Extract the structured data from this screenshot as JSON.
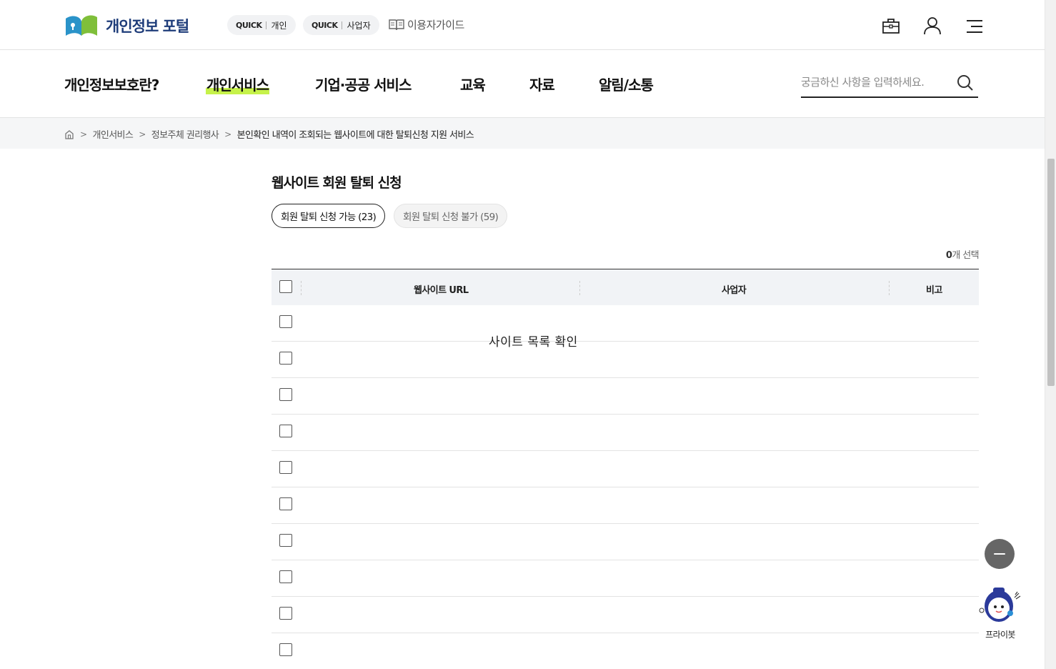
{
  "header": {
    "logo_text": "개인정보 포털",
    "quick_personal": {
      "tag": "QUICK",
      "label": "개인"
    },
    "quick_business": {
      "tag": "QUICK",
      "label": "사업자"
    },
    "guide_label": "이용자가이드",
    "icons": [
      "bag-icon",
      "user-icon",
      "menu-icon"
    ]
  },
  "nav": {
    "items": [
      {
        "label": "개인정보보호란?"
      },
      {
        "label": "개인서비스",
        "active": true
      },
      {
        "label": "기업·공공 서비스"
      },
      {
        "label": "교육"
      },
      {
        "label": "자료"
      },
      {
        "label": "알림/소통"
      }
    ],
    "search_placeholder": "궁금하신 사항을 입력하세요."
  },
  "breadcrumb": {
    "items": [
      "개인서비스",
      "정보주체 권리행사"
    ],
    "current": "본인확인 내역이 조회되는 웹사이트에 대한 탈퇴신청 지원 서비스"
  },
  "main": {
    "title": "웹사이트 회원 탈퇴 신청",
    "tabs": [
      {
        "label": "회원 탈퇴 신청 가능 (23)",
        "active": true
      },
      {
        "label": "회원 탈퇴 신청 불가 (59)",
        "active": false
      }
    ],
    "selected_count": "0",
    "selected_suffix": "개 선택",
    "table": {
      "columns": [
        "웹사이트 URL",
        "사업자",
        "비고"
      ],
      "row_count": 10
    },
    "empty_message": "사이트 목록 확인"
  },
  "floating": {
    "chatbot_label": "프라이봇"
  },
  "colors": {
    "accent": "#c6f24a",
    "brand": "#1f3d7a",
    "header_bg": "#f1f3f6"
  }
}
